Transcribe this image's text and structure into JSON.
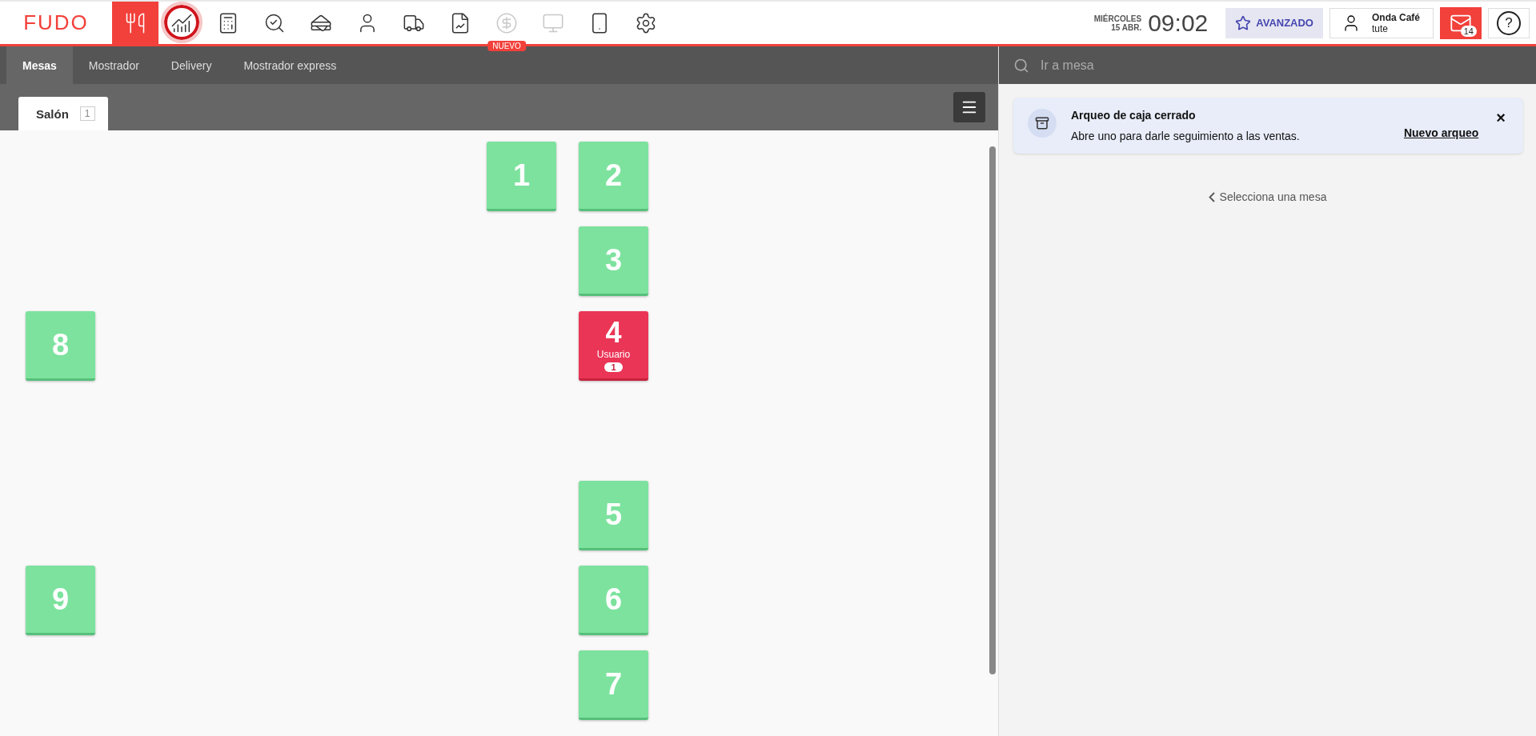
{
  "logo": "FUDO",
  "nav": [
    {
      "selected": true,
      "disabled": false,
      "highlighted": false
    },
    {
      "selected": false,
      "disabled": false,
      "highlighted": true
    },
    {
      "selected": false,
      "disabled": false,
      "highlighted": false
    },
    {
      "selected": false,
      "disabled": false,
      "highlighted": false
    },
    {
      "selected": false,
      "disabled": false,
      "highlighted": false
    },
    {
      "selected": false,
      "disabled": false,
      "highlighted": false
    },
    {
      "selected": false,
      "disabled": false,
      "highlighted": false
    },
    {
      "selected": false,
      "disabled": false,
      "highlighted": false
    },
    {
      "selected": false,
      "disabled": true,
      "highlighted": false,
      "badge": "NUEVO"
    },
    {
      "selected": false,
      "disabled": true,
      "highlighted": false
    },
    {
      "selected": false,
      "disabled": false,
      "highlighted": false
    },
    {
      "selected": false,
      "disabled": false,
      "highlighted": false
    }
  ],
  "date": {
    "weekday": "MIÉRCOLES",
    "day": "15 ABR.",
    "time": "09:02"
  },
  "plan": "AVANZADO",
  "user": {
    "name": "Onda Café",
    "login": "tute"
  },
  "messages": {
    "count": "14"
  },
  "help": "?",
  "tabs": [
    {
      "label": "Mesas",
      "selected": true
    },
    {
      "label": "Mostrador",
      "selected": false
    },
    {
      "label": "Delivery",
      "selected": false
    },
    {
      "label": "Mostrador express",
      "selected": false
    }
  ],
  "rooms": [
    {
      "label": "Salón",
      "count": "1",
      "selected": true
    }
  ],
  "tables": [
    {
      "number": "1",
      "kind": "free"
    },
    {
      "number": "2",
      "kind": "free"
    },
    {
      "number": "3",
      "kind": "free"
    },
    {
      "number": "8",
      "kind": "free"
    },
    {
      "number": "4",
      "kind": "occupied",
      "waiter": "Usuario",
      "guests": "1"
    },
    {
      "number": "5",
      "kind": "free"
    },
    {
      "number": "9",
      "kind": "free"
    },
    {
      "number": "6",
      "kind": "free"
    },
    {
      "number": "7",
      "kind": "free"
    }
  ],
  "search": {
    "placeholder": "Ir a mesa"
  },
  "alert": {
    "title": "Arqueo de caja cerrado",
    "text": "Abre uno para darle seguimiento a las ventas.",
    "link": "Nuevo arqueo",
    "close": "×"
  },
  "hint": "Selecciona una mesa"
}
